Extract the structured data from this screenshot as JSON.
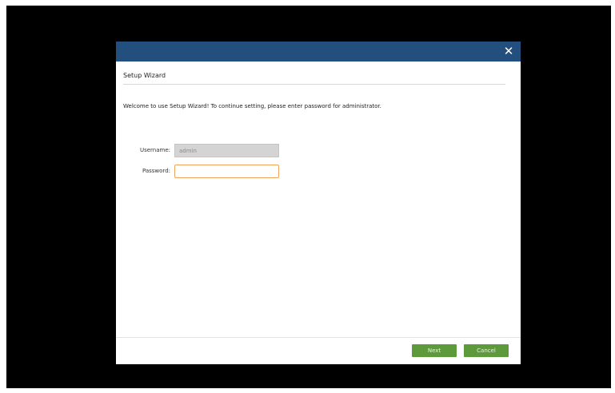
{
  "dialog": {
    "close_glyph": "✕",
    "heading": "Setup Wizard",
    "intro": "Welcome to use Setup Wizard! To continue setting, please enter password for administrator."
  },
  "form": {
    "username_label": "Username:",
    "username_value": "admin",
    "password_label": "Password:",
    "password_value": ""
  },
  "buttons": {
    "next_label": "Next",
    "cancel_label": "Cancel"
  },
  "colors": {
    "titlebar": "#234f7e",
    "button": "#5c9a3c",
    "focus_border": "#f2a35c"
  },
  "icons": {
    "close": "close-icon"
  }
}
